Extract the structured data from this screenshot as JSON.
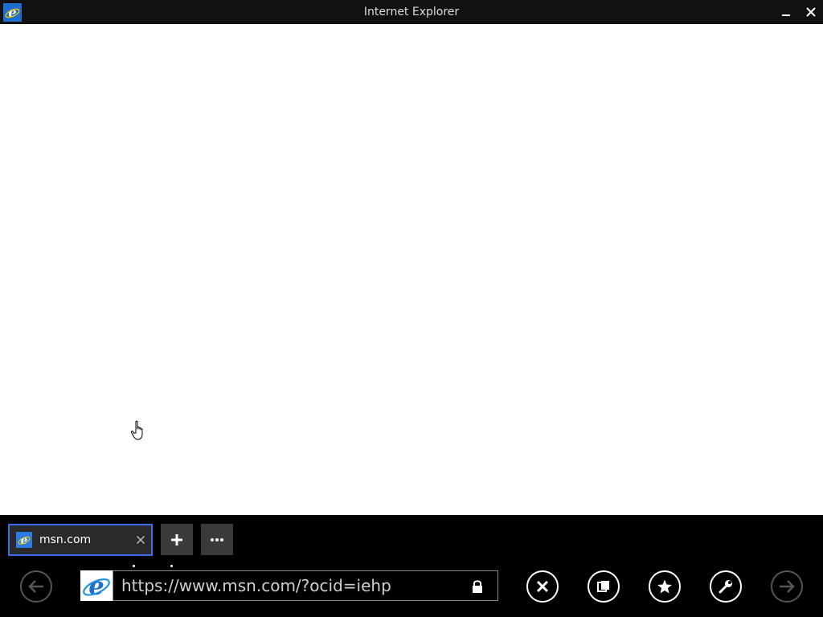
{
  "window": {
    "title": "Internet Explorer",
    "app_icon": "ie-logo-icon",
    "minimize_icon": "minimize-icon",
    "close_icon": "close-icon"
  },
  "tabs": [
    {
      "label": "msn.com",
      "favicon": "ie-logo-icon",
      "active": true,
      "close_icon": "close-icon"
    }
  ],
  "tab_controls": {
    "new_tab_icon": "plus-icon",
    "more_icon": "ellipsis-icon"
  },
  "navbar": {
    "back_icon": "back-arrow-icon",
    "site_icon": "ie-logo-icon",
    "address": "https://www.msn.com/?ocid=iehp",
    "lock_icon": "lock-icon",
    "stop_icon": "stop-icon",
    "tabs_icon": "tabs-icon",
    "favorites_icon": "star-icon",
    "tools_icon": "wrench-icon",
    "forward_icon": "forward-arrow-icon"
  },
  "colors": {
    "accent": "#3b6ee8",
    "titlebar": "#111111",
    "appbar": "#000000",
    "ie_blue": "#1f6fd0"
  }
}
